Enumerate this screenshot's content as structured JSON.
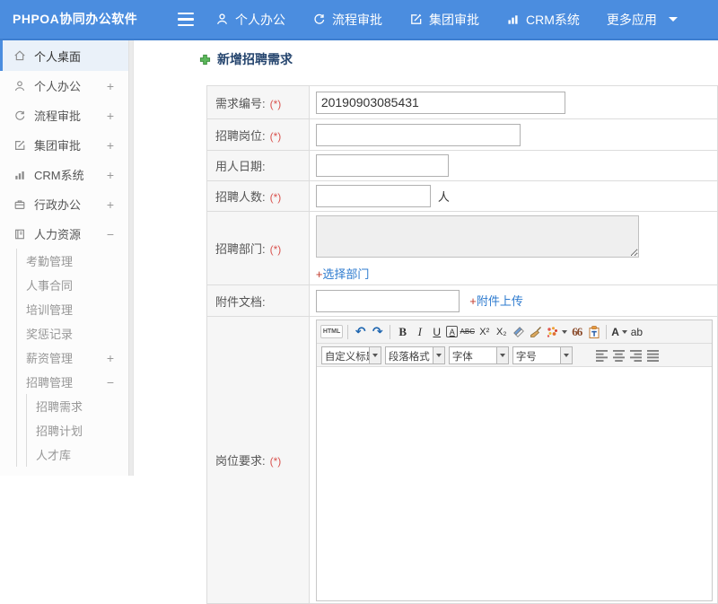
{
  "colors": {
    "accent": "#4b8ddf",
    "link": "#2e7bcf",
    "required": "#d9534f",
    "title_text": "#25456e",
    "link_plus": "#c0392b"
  },
  "navbar": {
    "logo": "PHPOA协同办公软件",
    "items": [
      {
        "label": "个人办公",
        "icon": "user-icon"
      },
      {
        "label": "流程审批",
        "icon": "workflow-icon"
      },
      {
        "label": "集团审批",
        "icon": "approval-edit-icon"
      },
      {
        "label": "CRM系统",
        "icon": "bar-chart-icon"
      },
      {
        "label": "更多应用",
        "icon": "dropdown-caret"
      }
    ]
  },
  "sidebar": {
    "items": [
      {
        "label": "个人桌面",
        "icon": "home-icon",
        "active": true
      },
      {
        "label": "个人办公",
        "icon": "user-icon",
        "expand": "+"
      },
      {
        "label": "流程审批",
        "icon": "workflow-icon",
        "expand": "+"
      },
      {
        "label": "集团审批",
        "icon": "approval-edit-icon",
        "expand": "+"
      },
      {
        "label": "CRM系统",
        "icon": "bar-chart-icon",
        "expand": "+"
      },
      {
        "label": "行政办公",
        "icon": "briefcase-icon",
        "expand": "+"
      },
      {
        "label": "人力资源",
        "icon": "hr-book-icon",
        "expand": "−",
        "children": [
          {
            "label": "考勤管理"
          },
          {
            "label": "人事合同"
          },
          {
            "label": "培训管理"
          },
          {
            "label": "奖惩记录"
          },
          {
            "label": "薪资管理",
            "expand": "+"
          },
          {
            "label": "招聘管理",
            "expand": "−",
            "children": [
              {
                "label": "招聘需求"
              },
              {
                "label": "招聘计划"
              },
              {
                "label": "人才库"
              }
            ]
          }
        ]
      }
    ]
  },
  "main": {
    "title": "新增招聘需求",
    "form": {
      "rows": [
        {
          "label": "需求编号:",
          "required": "(*)",
          "value": "20190903085431"
        },
        {
          "label": "招聘岗位:",
          "required": "(*)",
          "value": ""
        },
        {
          "label": "用人日期:",
          "value": ""
        },
        {
          "label": "招聘人数:",
          "required": "(*)",
          "value": "",
          "suffix": "人"
        },
        {
          "label": "招聘部门:",
          "required": "(*)",
          "link_plus": "+",
          "link_text": "选择部门"
        },
        {
          "label": "附件文档:",
          "value": "",
          "link_plus": "+",
          "link_text": "附件上传"
        },
        {
          "label": "岗位要求:",
          "required": "(*)"
        }
      ]
    }
  },
  "editor": {
    "buttons": {
      "html": "HTML",
      "undo": "↶",
      "redo": "↷",
      "bold": "B",
      "italic": "I",
      "underline": "U",
      "box_a": "A",
      "strike": "ABC",
      "sup": "X²",
      "sub": "X₂",
      "quote": "66",
      "font_color": "A",
      "bg_color": "ab"
    },
    "selects": [
      {
        "label": "自定义标题"
      },
      {
        "label": "段落格式"
      },
      {
        "label": "字体"
      },
      {
        "label": "字号"
      }
    ]
  }
}
